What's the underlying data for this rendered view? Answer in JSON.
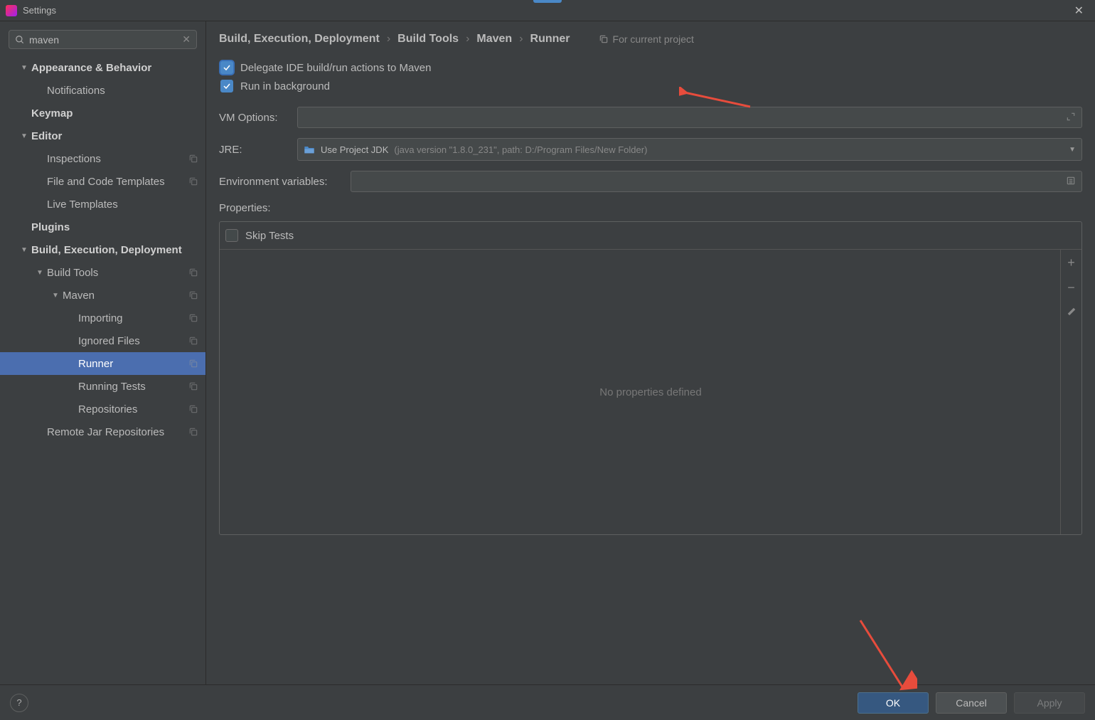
{
  "title": "Settings",
  "search": {
    "value": "maven"
  },
  "sidebar": {
    "items": [
      {
        "label": "Appearance & Behavior",
        "bold": true,
        "arrow": "▼",
        "indent": 1
      },
      {
        "label": "Notifications",
        "indent": 2
      },
      {
        "label": "Keymap",
        "bold": true,
        "indent": 1
      },
      {
        "label": "Editor",
        "bold": true,
        "arrow": "▼",
        "indent": 1
      },
      {
        "label": "Inspections",
        "indent": 2,
        "copy": true
      },
      {
        "label": "File and Code Templates",
        "indent": 2,
        "copy": true
      },
      {
        "label": "Live Templates",
        "indent": 2
      },
      {
        "label": "Plugins",
        "bold": true,
        "indent": 1
      },
      {
        "label": "Build, Execution, Deployment",
        "bold": true,
        "arrow": "▼",
        "indent": 1
      },
      {
        "label": "Build Tools",
        "arrow": "▼",
        "indent": 2,
        "copy": true
      },
      {
        "label": "Maven",
        "arrow": "▼",
        "indent": 3,
        "copy": true
      },
      {
        "label": "Importing",
        "indent": 4,
        "copy": true
      },
      {
        "label": "Ignored Files",
        "indent": 4,
        "copy": true
      },
      {
        "label": "Runner",
        "indent": 4,
        "copy": true,
        "selected": true
      },
      {
        "label": "Running Tests",
        "indent": 4,
        "copy": true
      },
      {
        "label": "Repositories",
        "indent": 4,
        "copy": true
      },
      {
        "label": "Remote Jar Repositories",
        "indent": 2,
        "copy": true
      }
    ]
  },
  "breadcrumb": {
    "parts": [
      "Build, Execution, Deployment",
      "Build Tools",
      "Maven",
      "Runner"
    ],
    "scope": "For current project"
  },
  "form": {
    "delegate_label": "Delegate IDE build/run actions to Maven",
    "delegate_checked": true,
    "background_label": "Run in background",
    "background_checked": true,
    "vm_label": "VM Options:",
    "vm_value": "",
    "jre_label": "JRE:",
    "jre_main": "Use Project JDK",
    "jre_detail": "(java version \"1.8.0_231\", path: D:/Program Files/New Folder)",
    "env_label": "Environment variables:",
    "env_value": "",
    "properties_label": "Properties:",
    "skip_tests_label": "Skip Tests",
    "skip_tests_checked": false,
    "no_props": "No properties defined"
  },
  "footer": {
    "ok": "OK",
    "cancel": "Cancel",
    "apply": "Apply"
  }
}
